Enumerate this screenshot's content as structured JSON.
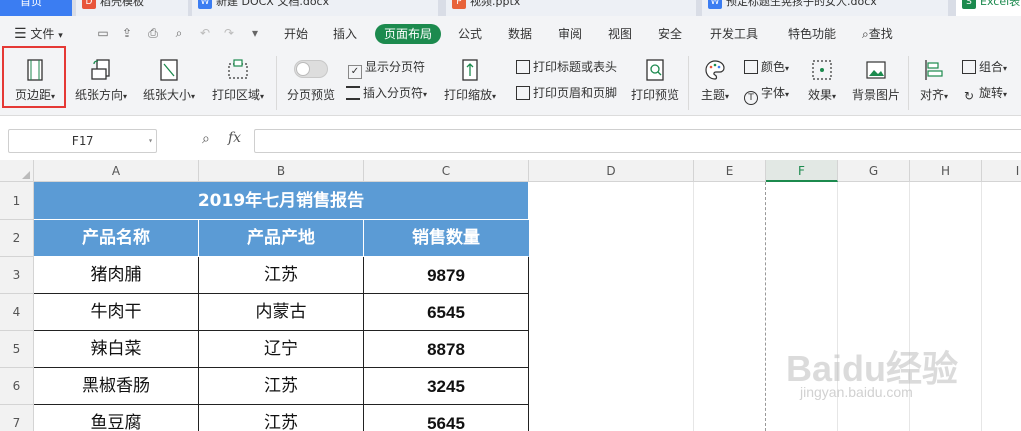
{
  "tabs": [
    {
      "label": "首页",
      "active": true
    },
    {
      "label": "稻壳模板"
    },
    {
      "label": "新建 DOCX 文档.docx"
    },
    {
      "label": "视频.pptx"
    },
    {
      "label": "预定标题生晃孩子的女人.docx"
    },
    {
      "label": "Excel表"
    }
  ],
  "menu": {
    "file": "文件",
    "start": "开始",
    "insert": "插入",
    "page_layout": "页面布局",
    "formula": "公式",
    "data": "数据",
    "review": "审阅",
    "view": "视图",
    "security": "安全",
    "dev_tools": "开发工具",
    "special": "特色功能",
    "search": "查找"
  },
  "ribbon": {
    "margins": "页边距",
    "orientation": "纸张方向",
    "size": "纸张大小",
    "print_area": "打印区域",
    "page_break_preview": "分页预览",
    "show_page_break": "显示分页符",
    "insert_page_break": "插入分页符",
    "print_scale": "打印缩放",
    "print_titles": "打印标题或表头",
    "print_header_footer": "打印页眉和页脚",
    "print_preview": "打印预览",
    "theme": "主题",
    "colors": "颜色",
    "fonts": "字体",
    "effects": "效果",
    "bg_image": "背景图片",
    "align": "对齐",
    "group": "组合",
    "rotate": "旋转"
  },
  "formula_bar": {
    "cell_ref": "F17",
    "fx": "fx",
    "value": ""
  },
  "columns": [
    "A",
    "B",
    "C",
    "D",
    "E",
    "F",
    "G",
    "H",
    "I"
  ],
  "rows": [
    "1",
    "2",
    "3",
    "4",
    "5",
    "6",
    "7"
  ],
  "table": {
    "title": "2019年七月销售报告",
    "headers": [
      "产品名称",
      "产品产地",
      "销售数量"
    ],
    "rows": [
      [
        "猪肉脯",
        "江苏",
        "9879"
      ],
      [
        "牛肉干",
        "内蒙古",
        "6545"
      ],
      [
        "辣白菜",
        "辽宁",
        "8878"
      ],
      [
        "黑椒香肠",
        "江苏",
        "3245"
      ],
      [
        "鱼豆腐",
        "江苏",
        "5645"
      ]
    ]
  },
  "watermark": {
    "brand": "Baidu经验",
    "url": "jingyan.baidu.com"
  },
  "colors": {
    "accent_green": "#1c8a4e",
    "header_blue": "#5b9bd5",
    "highlight_red": "#e53935"
  }
}
